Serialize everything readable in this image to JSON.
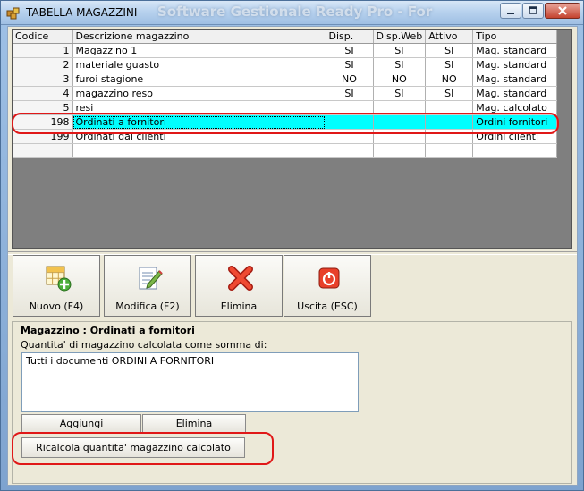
{
  "window": {
    "title": "TABELLA MAGAZZINI",
    "background_title": "Software Gestionale Ready Pro - For"
  },
  "table": {
    "headers": [
      "Codice",
      "Descrizione magazzino",
      "Disp.",
      "Disp.Web",
      "Attivo",
      "Tipo"
    ],
    "rows": [
      {
        "codice": "1",
        "descrizione": "Magazzino 1",
        "disp": "SI",
        "disp_web": "SI",
        "attivo": "SI",
        "tipo": "Mag. standard"
      },
      {
        "codice": "2",
        "descrizione": "materiale guasto",
        "disp": "SI",
        "disp_web": "SI",
        "attivo": "SI",
        "tipo": "Mag. standard"
      },
      {
        "codice": "3",
        "descrizione": "furoi stagione",
        "disp": "NO",
        "disp_web": "NO",
        "attivo": "NO",
        "tipo": "Mag. standard"
      },
      {
        "codice": "4",
        "descrizione": "magazzino reso",
        "disp": "SI",
        "disp_web": "SI",
        "attivo": "SI",
        "tipo": "Mag. standard"
      },
      {
        "codice": "5",
        "descrizione": "resi",
        "disp": "",
        "disp_web": "",
        "attivo": "",
        "tipo": "Mag. calcolato"
      },
      {
        "codice": "198",
        "descrizione": "Ordinati a fornitori",
        "disp": "",
        "disp_web": "",
        "attivo": "",
        "tipo": "Ordini fornitori"
      },
      {
        "codice": "199",
        "descrizione": "Ordinati dai clienti",
        "disp": "",
        "disp_web": "",
        "attivo": "",
        "tipo": "Ordini clienti"
      }
    ],
    "selected_codice": "198",
    "highlight_color": "#00ffff"
  },
  "toolbar": {
    "nuovo": "Nuovo (F4)",
    "modifica": "Modifica (F2)",
    "elimina": "Elimina",
    "uscita": "Uscita (ESC)"
  },
  "detail": {
    "title": "Magazzino : Ordinati a fornitori",
    "caption": "Quantita' di magazzino calcolata come somma di:",
    "memo_text": "Tutti i documenti ORDINI A FORNITORI",
    "aggiungi": "Aggiungi",
    "elimina": "Elimina",
    "ricalcola": "Ricalcola quantita' magazzino calcolato"
  },
  "annotation_color": "#e01818"
}
